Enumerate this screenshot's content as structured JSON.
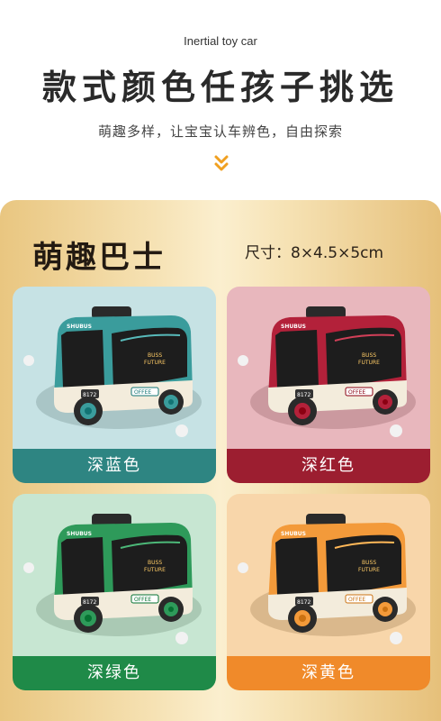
{
  "header": {
    "subtitle_en": "Inertial toy car",
    "headline": "款式颜色任孩子挑选",
    "description": "萌趣多样，让宝宝认车辨色，自由探索",
    "chevron_icon": "double-chevron-down-icon",
    "accent_color": "#f0a020"
  },
  "section": {
    "title": "萌趣巴士",
    "size": "尺寸：8×4.5×5cm"
  },
  "cards": [
    {
      "label": "深蓝色",
      "bus_color": "#3a9c9c",
      "bg_color": "#c6e2e4",
      "label_bg": "#2e8582",
      "plate": "8172"
    },
    {
      "label": "深红色",
      "bus_color": "#b3213a",
      "bg_color": "#e8b7bd",
      "label_bg": "#9c1e30",
      "plate": "8172"
    },
    {
      "label": "深绿色",
      "bus_color": "#2e9a5a",
      "bg_color": "#c7e6d2",
      "label_bg": "#1f8a48",
      "plate": "8172"
    },
    {
      "label": "深黄色",
      "bus_color": "#f39a3a",
      "bg_color": "#f8d6aa",
      "label_bg": "#f08a2a",
      "plate": "8172"
    }
  ],
  "bus_text": {
    "front_badge": "SHUBUS",
    "side_line1": "BUSS",
    "side_line2": "FUTURE",
    "side_plate": "OFFEE"
  }
}
